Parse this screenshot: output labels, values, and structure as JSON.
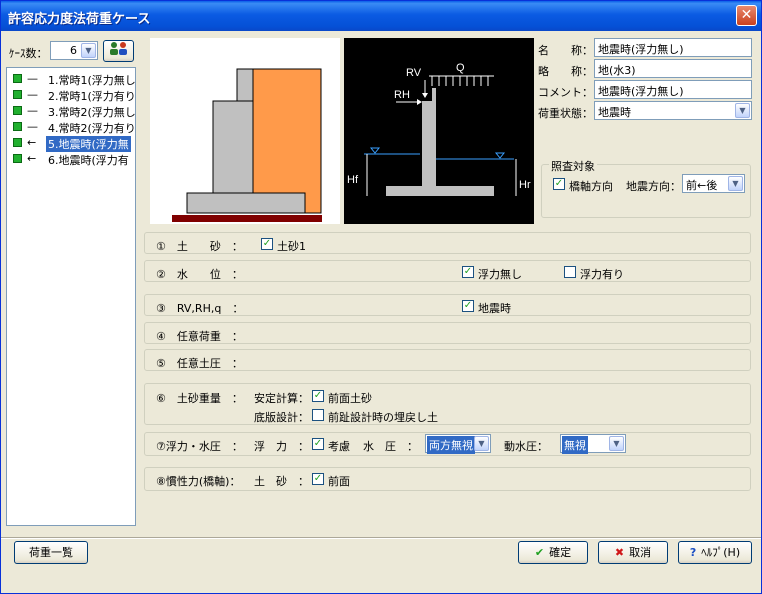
{
  "window": {
    "title": "許容応力度法荷重ケース"
  },
  "left_panel": {
    "case_count_label": "ｹｰｽ数：",
    "case_count_value": "6",
    "cases": [
      {
        "label": "1.常時1(浮力無し",
        "dash": "—",
        "selected": false
      },
      {
        "label": "2.常時1(浮力有り",
        "dash": "—",
        "selected": false
      },
      {
        "label": "3.常時2(浮力無し",
        "dash": "—",
        "selected": false
      },
      {
        "label": "4.常時2(浮力有り",
        "dash": "—",
        "selected": false
      },
      {
        "label": "5.地震時(浮力無",
        "dash": "←",
        "selected": true
      },
      {
        "label": "6.地震時(浮力有",
        "dash": "←",
        "selected": false
      }
    ]
  },
  "diagram": {
    "rv": "RV",
    "q": "Q",
    "rh": "RH",
    "hf": "Hf",
    "hr": "Hr"
  },
  "properties": {
    "name_label": "名　　称：",
    "name_value": "地震時(浮力無し)",
    "abbr_label": "略　　称：",
    "abbr_value": "地(水3)",
    "comment_label": "コメント：",
    "comment_value": "地震時(浮力無し)",
    "load_state_label": "荷重状態：",
    "load_state_value": "地震時"
  },
  "check_target": {
    "title": "照査対象",
    "bridge_axis_label": "橋軸方向",
    "bridge_axis_checked": true,
    "quake_dir_label": "地震方向：",
    "quake_dir_value": "前←後"
  },
  "rows": {
    "r1": {
      "label": "①　土　　砂　：",
      "chk_label": "土砂1",
      "checked": true
    },
    "r2": {
      "label": "②　水　　位　：",
      "chk1_label": "浮力無し",
      "chk1": true,
      "chk2_label": "浮力有り",
      "chk2": false
    },
    "r3": {
      "label": "③　RV,RH,q　：",
      "chk_label": "地震時",
      "checked": true
    },
    "r4": {
      "label": "④　任意荷重　："
    },
    "r5": {
      "label": "⑤　任意土圧　："
    },
    "r6": {
      "label": "⑥　土砂重量　：",
      "stability_label": "安定計算：",
      "stability_chk_label": "前面土砂",
      "stability_checked": true,
      "slab_label": "底版設計：",
      "slab_chk_label": "前趾設計時の埋戻し土",
      "slab_checked": false
    },
    "r7": {
      "label": "⑦浮力・水圧　：",
      "buoyancy_label": "浮　力　：",
      "buoyancy_chk_label": "考慮",
      "buoyancy_checked": true,
      "water_label": "水　圧　：",
      "water_value": "両方無視",
      "dynamic_label": "動水圧：",
      "dynamic_value": "無視"
    },
    "r8": {
      "label": "⑧慣性力(橋軸)：",
      "soil_label": "土　砂　：",
      "chk_label": "前面",
      "checked": true
    }
  },
  "buttons": {
    "load_list": "荷重一覧",
    "ok": "確定",
    "cancel": "取消",
    "help": "ﾍﾙﾌﾟ(H)"
  },
  "colors": {
    "title_bar": "#0a5fe8",
    "selection": "#316ac5",
    "tree_node": "#21b02f",
    "structure_fill": "#c0c0c0",
    "soil_fill": "#ff9a4a",
    "base_fill": "#800000",
    "water": "#3aa0ff"
  }
}
